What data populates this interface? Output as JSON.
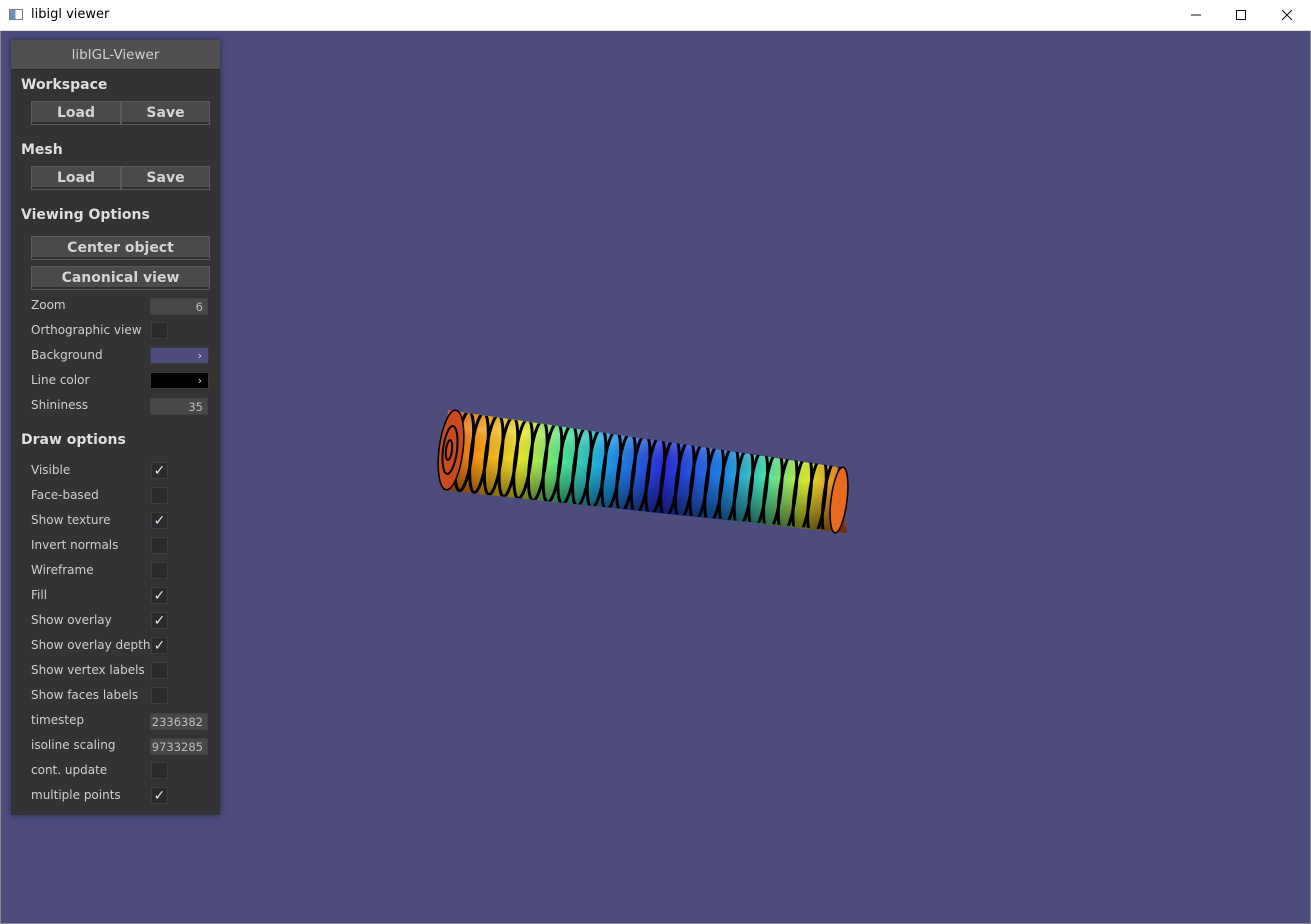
{
  "window": {
    "title": "libigl viewer",
    "controls": {
      "minimize": "—",
      "maximize": "☐",
      "close": "✕"
    }
  },
  "panel": {
    "title": "libIGL-Viewer",
    "workspace": {
      "heading": "Workspace",
      "load_label": "Load",
      "save_label": "Save"
    },
    "mesh": {
      "heading": "Mesh",
      "load_label": "Load",
      "save_label": "Save"
    },
    "viewing": {
      "heading": "Viewing Options",
      "center_label": "Center object",
      "canonical_label": "Canonical view",
      "zoom": {
        "label": "Zoom",
        "value": "6"
      },
      "orthographic": {
        "label": "Orthographic view",
        "checked": false
      },
      "background": {
        "label": "Background",
        "color": "#4d4c7d"
      },
      "line_color": {
        "label": "Line color",
        "color": "#000000"
      },
      "shininess": {
        "label": "Shininess",
        "value": "35"
      }
    },
    "draw": {
      "heading": "Draw options",
      "options": [
        {
          "label": "Visible",
          "checked": true
        },
        {
          "label": "Face-based",
          "checked": false
        },
        {
          "label": "Show texture",
          "checked": true
        },
        {
          "label": "Invert normals",
          "checked": false
        },
        {
          "label": "Wireframe",
          "checked": false
        },
        {
          "label": "Fill",
          "checked": true
        },
        {
          "label": "Show overlay",
          "checked": true
        },
        {
          "label": "Show overlay depth",
          "checked": true
        },
        {
          "label": "Show vertex labels",
          "checked": false
        },
        {
          "label": "Show faces labels",
          "checked": false
        }
      ],
      "timestep": {
        "label": "timestep",
        "value": "2336382"
      },
      "isoline": {
        "label": "isoline scaling",
        "value": "9733285"
      },
      "cont_update": {
        "label": "cont. update",
        "checked": false
      },
      "multiple_points": {
        "label": "multiple points",
        "checked": true
      }
    }
  },
  "checkmark_glyph": "✓",
  "chevron_glyph": "›",
  "colors": {
    "viewport_bg": "#4d4c7d",
    "panel_bg": "#333336",
    "button_bg": "#4a4a4c"
  }
}
